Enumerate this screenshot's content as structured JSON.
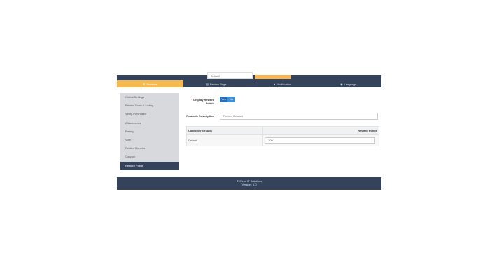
{
  "top": {
    "input_value": "Default"
  },
  "tabs": [
    {
      "label": "Reviews",
      "icon": "gear-icon",
      "active": true
    },
    {
      "label": "Review Page",
      "icon": "document-icon",
      "active": false
    },
    {
      "label": "Notification",
      "icon": "bell-icon",
      "active": false
    },
    {
      "label": "Language",
      "icon": "globe-icon",
      "active": false
    }
  ],
  "sidebar": {
    "items": [
      {
        "label": "Global Settings"
      },
      {
        "label": "Review Form & Listing"
      },
      {
        "label": "Verify Purchased"
      },
      {
        "label": "Attachments"
      },
      {
        "label": "Rating"
      },
      {
        "label": "Vote"
      },
      {
        "label": "Review Reports"
      },
      {
        "label": "Coupon"
      },
      {
        "label": "Reward Points",
        "active": true
      }
    ]
  },
  "form": {
    "display_label": "Display Reward Points",
    "required_mark": "*",
    "yes": "Yes",
    "no": "No",
    "desc_label": "Rewards Description",
    "desc_placeholder": "Review Reward",
    "table": {
      "col_group": "Customer Groups",
      "col_points": "Reward Points",
      "rows": [
        {
          "group": "Default",
          "points": "100"
        }
      ]
    }
  },
  "footer": {
    "line1": "© Webx IT Solutions",
    "line2": "Version: 1.0"
  },
  "colors": {
    "accent": "#f5b94e",
    "navy": "#34425a",
    "button": "#3a8fd8"
  }
}
